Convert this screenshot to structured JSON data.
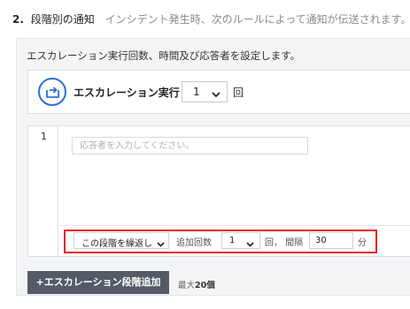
{
  "section": {
    "number": "2.",
    "title": "段階別の通知",
    "description": "インシデント発生時、次のルールによって通知が伝送されます。"
  },
  "panel": {
    "description": "エスカレーション実行回数、時間及び応答者を設定します。"
  },
  "escalation": {
    "label": "エスカレーション実行",
    "count_value": "1",
    "unit": "回",
    "icon": "escalation-repeat-icon",
    "accent_color": "#2d6fd6"
  },
  "step": {
    "number": "1",
    "responder_placeholder": "応答者を入力してください。",
    "repeat_option": "この段階を繰返し",
    "add_count_label": "追加回数",
    "add_count_value": "1",
    "count_unit_interval_label": "回， 間隔",
    "interval_value": "30",
    "interval_unit": "分",
    "highlight_color": "#e32020"
  },
  "actions": {
    "add_step_label": "+エスカレーション段階追加",
    "max_note_prefix": "最大",
    "max_note_value": "20個"
  }
}
